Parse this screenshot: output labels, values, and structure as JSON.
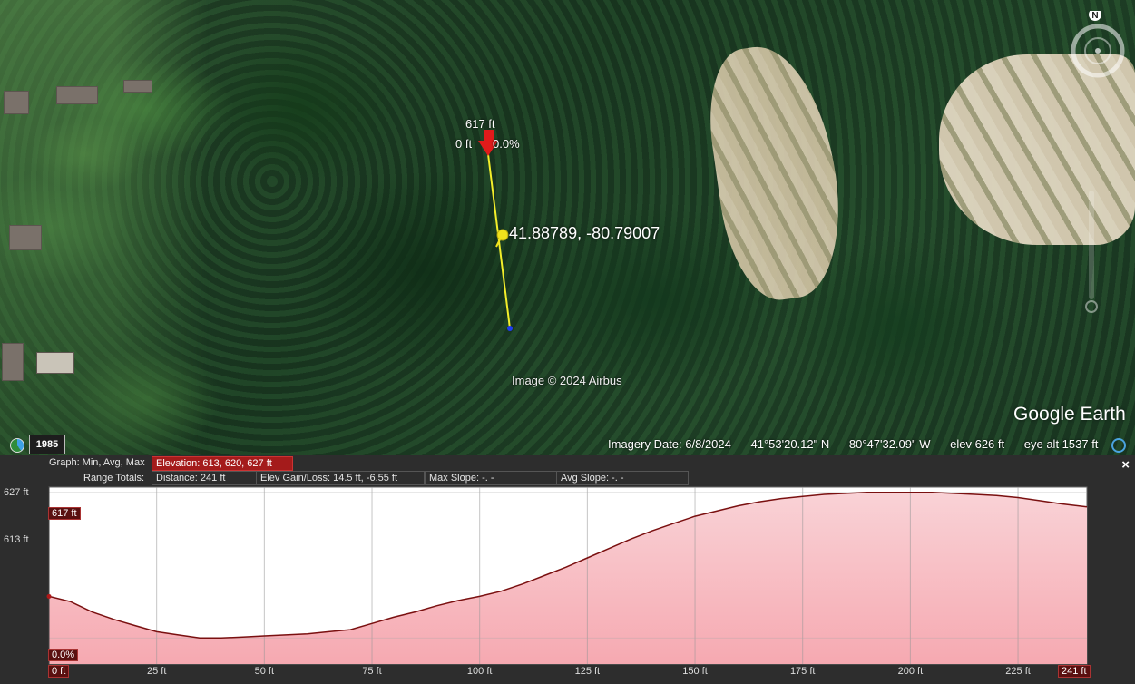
{
  "map": {
    "placemark_elevation": "617 ft",
    "placemark_distance": "0 ft",
    "placemark_slope": "0.0%",
    "pin_coordinates": "41.88789, -80.79007",
    "imagery_copyright": "Image © 2024 Airbus",
    "brand": "Google Earth",
    "compass_north": "N",
    "historical_year": "1985",
    "status": {
      "imagery_date": "Imagery Date: 6/8/2024",
      "latitude": "41°53'20.12\" N",
      "longitude": "80°47'32.09\" W",
      "elev": "elev  626 ft",
      "eye_alt": "eye alt  1537 ft"
    }
  },
  "profile": {
    "graph_caption": "Graph: Min, Avg, Max",
    "elevation_summary": "Elevation: 613, 620, 627 ft",
    "range_caption": "Range Totals:",
    "distance": "Distance: 241 ft",
    "gain_loss": "Elev Gain/Loss: 14.5 ft, -6.55 ft",
    "max_slope": "Max Slope: -. -",
    "avg_slope": "Avg Slope: -. -",
    "close_label": "×",
    "cursor_elevation": "617 ft",
    "cursor_slope": "0.0%",
    "cursor_distance": "0 ft",
    "end_distance": "241 ft"
  },
  "chart_data": {
    "type": "area",
    "title": "",
    "xlabel": "",
    "ylabel": "",
    "y_tick_labels": [
      "627 ft",
      "613 ft"
    ],
    "x_tick_labels": [
      "25 ft",
      "50 ft",
      "75 ft",
      "100 ft",
      "125 ft",
      "150 ft",
      "175 ft",
      "200 ft",
      "225 ft"
    ],
    "xlim": [
      0,
      241
    ],
    "ylim": [
      610.5,
      627.5
    ],
    "series": [
      {
        "x": [
          0,
          5,
          10,
          15,
          20,
          25,
          30,
          35,
          40,
          45,
          50,
          55,
          60,
          65,
          70,
          75,
          80,
          85,
          90,
          95,
          100,
          105,
          110,
          115,
          120,
          125,
          130,
          135,
          140,
          145,
          150,
          155,
          160,
          165,
          170,
          175,
          180,
          185,
          190,
          195,
          200,
          205,
          210,
          215,
          220,
          225,
          230,
          235,
          241
        ],
        "y": [
          617,
          616.5,
          615.5,
          614.8,
          614.2,
          613.6,
          613.3,
          613,
          613,
          613.1,
          613.2,
          613.3,
          613.4,
          613.6,
          613.8,
          614.4,
          615,
          615.5,
          616.1,
          616.6,
          617,
          617.5,
          618.2,
          619,
          619.8,
          620.7,
          621.6,
          622.5,
          623.3,
          624,
          624.7,
          625.2,
          625.7,
          626.1,
          626.4,
          626.6,
          626.8,
          626.9,
          627,
          627,
          627,
          627,
          626.9,
          626.8,
          626.7,
          626.5,
          626.2,
          625.9,
          625.6
        ]
      }
    ]
  }
}
